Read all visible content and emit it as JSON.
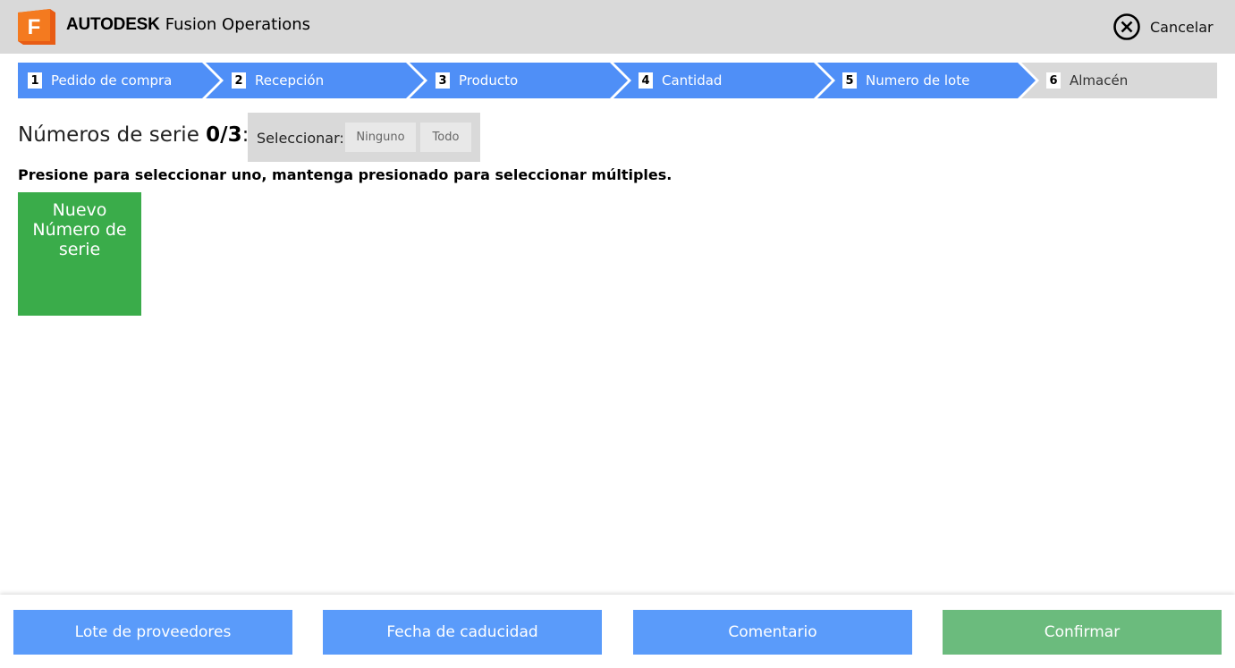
{
  "header": {
    "logo_letter": "F",
    "brand_strong": "AUTODESK",
    "brand_light": "Fusion Operations",
    "cancel_label": "Cancelar"
  },
  "steps": [
    {
      "num": "1",
      "label": "Pedido de compra",
      "state": "done"
    },
    {
      "num": "2",
      "label": "Recepción",
      "state": "done"
    },
    {
      "num": "3",
      "label": "Producto",
      "state": "done"
    },
    {
      "num": "4",
      "label": "Cantidad",
      "state": "done"
    },
    {
      "num": "5",
      "label": "Numero de lote",
      "state": "done"
    },
    {
      "num": "6",
      "label": "Almacén",
      "state": "pending"
    }
  ],
  "serials": {
    "title_prefix": "Números de serie",
    "count": "0/3",
    "title_suffix": ":",
    "select_label": "Seleccionar:",
    "none_label": "Ninguno",
    "all_label": "Todo",
    "instruction": "Presione para seleccionar uno, mantenga presionado para seleccionar múltiples.",
    "new_serial_lines": [
      "Nuevo",
      "Número de",
      "serie"
    ]
  },
  "footer": {
    "supplier_lot": "Lote de proveedores",
    "expiry_date": "Fecha de caducidad",
    "comment": "Comentario",
    "confirm": "Confirmar"
  },
  "colors": {
    "step_active": "#4f8ff7",
    "step_pending": "#d9d9d9",
    "header_bg": "#d9d9d9",
    "new_serial_green": "#3aac4a",
    "footer_blue": "#5a9bfa",
    "footer_green": "#6bbb7d"
  }
}
